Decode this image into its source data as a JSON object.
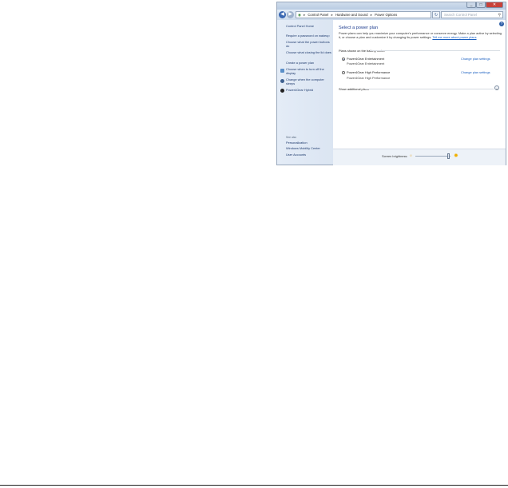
{
  "window": {
    "address_path": [
      "Control Panel",
      "Hardware and Sound",
      "Power Options"
    ],
    "search_placeholder": "Search Control Panel",
    "help_icon": "?"
  },
  "sidebar": {
    "home": "Control Panel Home",
    "links": [
      "Require a password on wakeup",
      "Choose what the power buttons do",
      "Choose what closing the lid does",
      "Create a power plan",
      "Choose when to turn off the display",
      "Change when the computer sleeps",
      "Power4Gear Hybrid"
    ],
    "see_also_title": "See also",
    "see_also": [
      "Personalization",
      "Windows Mobility Center",
      "User Accounts"
    ]
  },
  "main": {
    "title": "Select a power plan",
    "description": "Power plans can help you maximize your computer's performance or conserve energy. Make a plan active by selecting it, or choose a plan and customize it by changing its power settings.",
    "learn_more": "Tell me more about power plans",
    "section_title": "Plans shown on the battery meter",
    "plans": [
      {
        "name": "Power4Gear Entertainment",
        "subtitle": "Power4Gear Entertainment",
        "link": "Change plan settings",
        "selected": true
      },
      {
        "name": "Power4Gear High Performance",
        "subtitle": "Power4Gear High Performance",
        "link": "Change plan settings",
        "selected": false
      }
    ],
    "show_more": "Show additional plans",
    "brightness_label": "Screen brightness:"
  }
}
